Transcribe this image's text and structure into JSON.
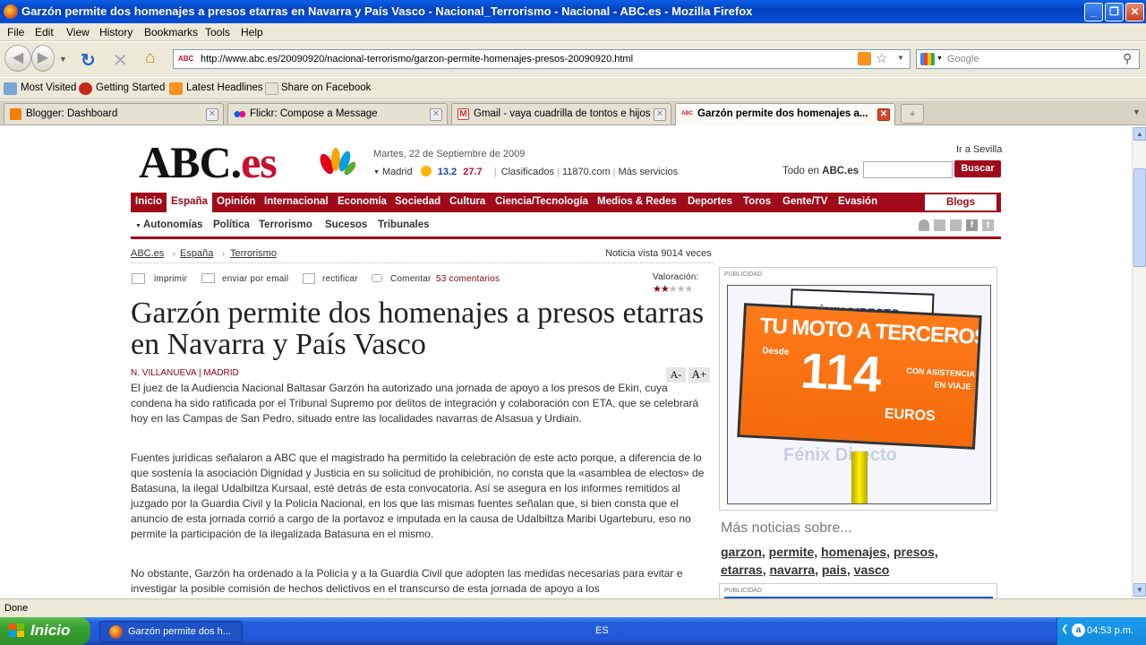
{
  "window": {
    "title": "Garzón permite dos homenajes a presos etarras en Navarra y País Vasco - Nacional_Terrorismo - Nacional - ABC.es - Mozilla Firefox"
  },
  "menu": [
    "File",
    "Edit",
    "View",
    "History",
    "Bookmarks",
    "Tools",
    "Help"
  ],
  "nav": {
    "url": "http://www.abc.es/20090920/nacional-terrorismo/garzon-permite-homenajes-presos-20090920.html",
    "search_placeholder": "Google"
  },
  "bookmarks": [
    "Most Visited",
    "Getting Started",
    "Latest Headlines",
    "Share on Facebook"
  ],
  "tabs": [
    {
      "label": "Blogger: Dashboard",
      "color": "#f57d00"
    },
    {
      "label": "Flickr: Compose a Message",
      "color": "#ff0084"
    },
    {
      "label": "Gmail - vaya cuadrilla de tontos e hijos ...",
      "color": "#d93025"
    },
    {
      "label": "Garzón permite dos homenajes a...",
      "color": "#c8102e"
    }
  ],
  "site": {
    "logo_main": "ABC.",
    "logo_es": "es",
    "date": "Martes, 22 de Septiembre de 2009",
    "weather_city": "Madrid",
    "temp_high": "13.2",
    "temp_low": "27.7",
    "links": [
      "Clasificados",
      "11870.com",
      "Más servicios"
    ],
    "ir_a": "Ir a Sevilla",
    "todo_en": "Todo en",
    "todo_brand": "ABC.es",
    "buscar": "Buscar",
    "blogs": "Blogs"
  },
  "mainnav": [
    "Inicio",
    "España",
    "Opinión",
    "Internacional",
    "Economía",
    "Sociedad",
    "Cultura",
    "Ciencia/Tecnología",
    "Medios & Redes",
    "Deportes",
    "Toros",
    "Gente/TV",
    "Evasión"
  ],
  "subnav": [
    "Autonomías",
    "Política",
    "Terrorismo",
    "Sucesos",
    "Tribunales"
  ],
  "breadcrumb": [
    "ABC.es",
    "España",
    "Terrorismo"
  ],
  "views": {
    "prefix": "Noticia vista",
    "count": "9014",
    "suffix": "veces"
  },
  "tools": {
    "imprimir": "imprimir",
    "email": "enviar por email",
    "rectificar": "rectificar",
    "comentar": "Comentar",
    "comments": "53 comentarios",
    "valoracion": "Valoración:",
    "rating": 2,
    "font_small": "A-",
    "font_large": "A+"
  },
  "article": {
    "headline": "Garzón permite dos homenajes a presos etarras en Navarra y País Vasco",
    "author": "N. VILLANUEVA | MADRID",
    "p1": "El juez de la Audiencia Nacional Baltasar Garzón ha autorizado una jornada de apoyo a los presos de Ekin, cuya condena ha sido ratificada por el Tribunal Supremo por delitos de integración y colaboración con ETA, que se celebrará hoy en las Campas de San Pedro, situado entre las localidades navarras de Alsasua y Urdiain.",
    "p2": "Fuentes jurídicas señalaron a ABC que el magistrado ha permitido la celebración de este acto porque, a diferencia de lo que sostenía la asociación Dignidad y Justicia en su solicitud de prohibición, no consta que la «asamblea de electos» de Batasuna, la ilegal Udalbiltza Kursaal, esté detrás de esta convocatoria. Así se asegura en los informes remitidos al juzgado por la Guardia Civil y la Policía Nacional, en los que las mismas fuentes señalan que, si bien consta que el anuncio de esta jornada corrió a cargo de la portavoz e imputada en la causa de Udalbiltza Maribi Ugarteburu, eso no permite la participación de la ilegalizada Batasuna en el mismo.",
    "p3": "No obstante, Garzón ha ordenado a la Policía y a la Guardia Civil que adopten las medidas necesarias para evitar e investigar la posible comisión de hechos delictivos en el transcurso de esta jornada de apoyo a los"
  },
  "ad": {
    "label": "PUBLICIDAD",
    "brand": "FÉNIX DIRECTO",
    "line1": "TU MOTO A TERCEROS",
    "desde": "Desde",
    "price": "114",
    "euros": "EUROS",
    "con": "CON ASISTENCIA",
    "viaje": "EN VIAJE",
    "bg_text": "Fénix Directo",
    "label2": "PUBLICIDAD"
  },
  "more": {
    "title": "Más noticias sobre...",
    "tags": [
      "garzon",
      "permite",
      "homenajes",
      "presos",
      "etarras",
      "navarra",
      "pais",
      "vasco"
    ]
  },
  "status": "Done",
  "taskbar": {
    "start": "Inicio",
    "task": "Garzón permite dos h...",
    "lang": "ES",
    "time": "04:53 p.m."
  }
}
